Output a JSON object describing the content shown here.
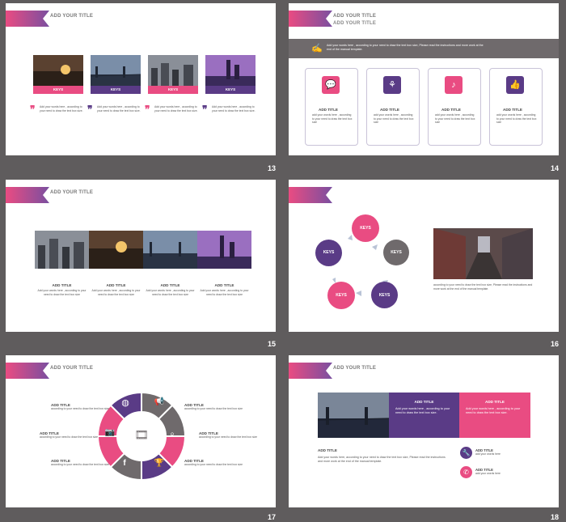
{
  "pages": [
    "13",
    "14",
    "15",
    "16",
    "17",
    "18"
  ],
  "add_your_title": "ADD YOUR TITLE",
  "keys": "KEYS",
  "add_title": "ADD TITLE",
  "s13": {
    "quote": "Add your words here , according to your need to draw the text box size."
  },
  "s14": {
    "banner": "Add your words here , according to your need to draw the text box size, Please read the instructions and more work at the end of the manual template.",
    "card_text": "add your words here , according to your need to draw the text box size",
    "icons": [
      "chat-icon",
      "flower-icon",
      "music-note-icon",
      "thumbs-up-icon"
    ]
  },
  "s15": {
    "text": "Add your words here , according to your need to draw the text box size"
  },
  "s16": {
    "desc": "according to your need to draw the text box size, Please read the instructions and more work at the end of the manual template."
  },
  "s17": {
    "text": "according to your need to draw the text box size",
    "icons": [
      "globe-icon",
      "megaphone-icon",
      "search-icon",
      "trophy-icon",
      "facebook-icon",
      "camera-icon",
      "film-icon"
    ]
  },
  "s18": {
    "box": "Add your words here , according to your need to draw the text box size.",
    "body": "Add your words here, according to your need to draw the text box size, Please read the instructions and more work at the end of the manual template.",
    "small": "add your words here",
    "icons": [
      "wrench-icon",
      "phone-icon"
    ]
  },
  "colors": {
    "magenta": "#e94c82",
    "purple": "#5a3b86",
    "gray": "#6f6a6c",
    "background": "#5f5c5d"
  }
}
